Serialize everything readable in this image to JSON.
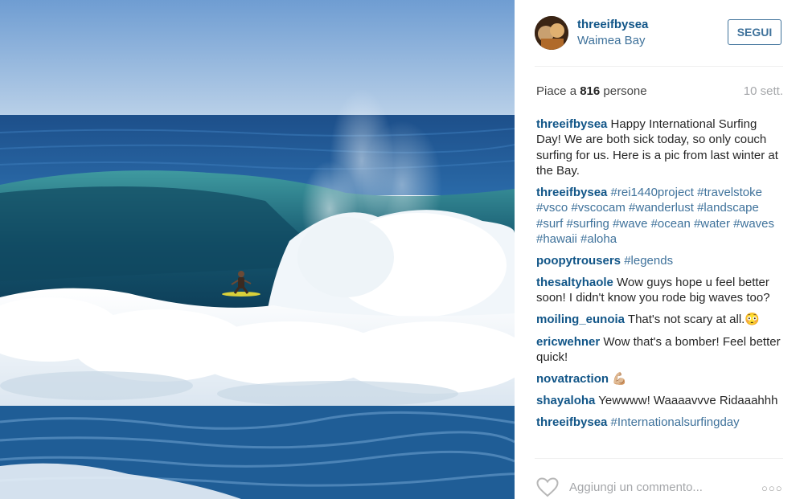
{
  "post": {
    "image_name": "surfer-big-wave-photo",
    "username": "threeifbysea",
    "location": "Waimea Bay",
    "follow_label": "SEGUI",
    "likes_prefix": "Piace a ",
    "likes_count": "816",
    "likes_suffix": " persone",
    "time_ago": "10 sett."
  },
  "comments": [
    {
      "user": "threeifbysea",
      "text": "Happy International Surfing Day! We are both sick today, so only couch surfing for us. Here is a pic from last winter at the Bay.",
      "is_tags": false
    },
    {
      "user": "threeifbysea",
      "text": "#rei1440project #travelstoke #vsco #vscocam #wanderlust #landscape #surf #surfing #wave #ocean #water #waves #hawaii #aloha",
      "is_tags": true
    },
    {
      "user": "poopytrousers",
      "text": "#legends",
      "is_tags": true
    },
    {
      "user": "thesaltyhaole",
      "text": "Wow guys hope u feel better soon! I didn't know you rode big waves too?",
      "is_tags": false
    },
    {
      "user": "moiling_eunoia",
      "text": "That's not scary at all.😳",
      "is_tags": false
    },
    {
      "user": "ericwehner",
      "text": "Wow that's a bomber! Feel better quick!",
      "is_tags": false
    },
    {
      "user": "novatraction",
      "text": "💪🏼",
      "is_tags": false
    },
    {
      "user": "shayaloha",
      "text": "Yewwww! Waaaavvve Ridaaahhh",
      "is_tags": false
    },
    {
      "user": "threeifbysea",
      "text": "#Internationalsurfingday",
      "is_tags": true
    }
  ],
  "footer": {
    "comment_placeholder": "Aggiungi un commento...",
    "like_icon": "heart-outline-icon",
    "more_icon": "more-options-icon",
    "more_glyph": "○○○"
  },
  "colors": {
    "username": "#125688",
    "hashtag": "#3f729b",
    "muted": "#a5a7aa",
    "follow_border": "#3f729b"
  }
}
